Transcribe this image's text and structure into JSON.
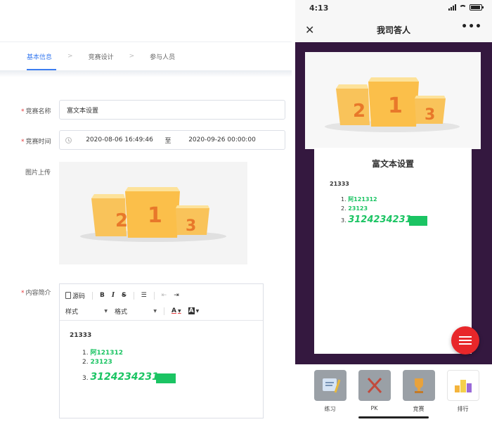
{
  "admin": {
    "steps": [
      "基本信息",
      "竞赛设计",
      "参与人员"
    ],
    "fields": {
      "name_label": "竞赛名称",
      "name_value": "富文本设置",
      "time_label": "竞赛时间",
      "time_start": "2020-08-06 16:49:46",
      "time_separator": "至",
      "time_end": "2020-09-26 00:00:00",
      "image_label": "图片上传",
      "intro_label": "内容简介"
    },
    "toolbar": {
      "source_label": "源码",
      "bold": "B",
      "italic": "I",
      "strike": "S",
      "style_select": "样式",
      "format_select": "格式",
      "font_color": "A",
      "bg_color": "A"
    },
    "editor": {
      "heading": "21333",
      "items": [
        {
          "num": "1.",
          "text": "阿121312"
        },
        {
          "num": "2.",
          "text": "23123"
        },
        {
          "num": "3.",
          "text": "3124234231"
        }
      ]
    },
    "podium": {
      "left": "2",
      "center": "1",
      "right": "3"
    }
  },
  "phone": {
    "status_time": "4:13",
    "battery_level": 0.9,
    "title": "我司答人",
    "close_icon": "close-icon",
    "more_icon": "more-icon",
    "card": {
      "title": "富文本设置",
      "heading": "21333",
      "items": [
        {
          "num": "1.",
          "text": "阿121312"
        },
        {
          "num": "2.",
          "text": "23123"
        },
        {
          "num": "3.",
          "text": "3124234231"
        }
      ]
    },
    "podium": {
      "left": "2",
      "center": "1",
      "right": "3"
    },
    "tabs": [
      {
        "label": "练习",
        "icon": "practice-icon"
      },
      {
        "label": "PK",
        "icon": "pk-swords-icon"
      },
      {
        "label": "竞赛",
        "icon": "trophy-icon"
      },
      {
        "label": "排行",
        "icon": "ranking-icon",
        "active": true
      }
    ]
  },
  "colors": {
    "accent": "#3c7df0",
    "green_text": "#1bc463",
    "phone_bg": "#34183f",
    "fab": "#e8272a"
  }
}
